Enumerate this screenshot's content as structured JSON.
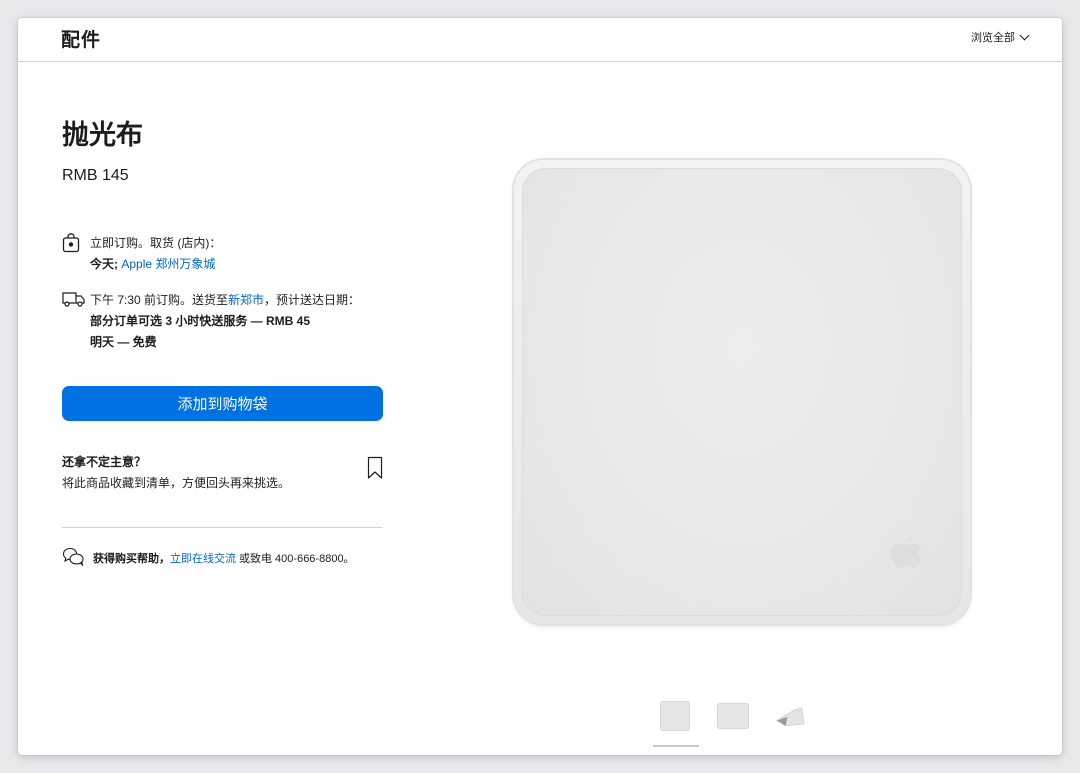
{
  "header": {
    "title": "配件",
    "browse_label": "浏览全部"
  },
  "product": {
    "title": "抛光布",
    "price": "RMB 145"
  },
  "pickup": {
    "line1": "立即订购。取货 (店内)：",
    "day": "今天;",
    "store_prefix": "Apple",
    "store_link": "郑州万象城"
  },
  "delivery": {
    "line1_prefix": "下午 7:30 前订购。送货至",
    "city_link": "新郑市",
    "line1_suffix": "，预计送达日期：",
    "line2": "部分订单可选 3 小时快送服务 — RMB 45",
    "line3": "明天 — 免费"
  },
  "actions": {
    "add_to_bag": "添加到购物袋"
  },
  "save": {
    "title": "还拿不定主意？",
    "subtitle": "将此商品收藏到清单，方便回头再来挑选。"
  },
  "help": {
    "label": "获得购买帮助，",
    "chat_link": "立即在线交流",
    "suffix": "或致电 400-666-8800。"
  },
  "colors": {
    "accent": "#0071e3",
    "link": "#0066cc",
    "text": "#1d1d1f"
  }
}
